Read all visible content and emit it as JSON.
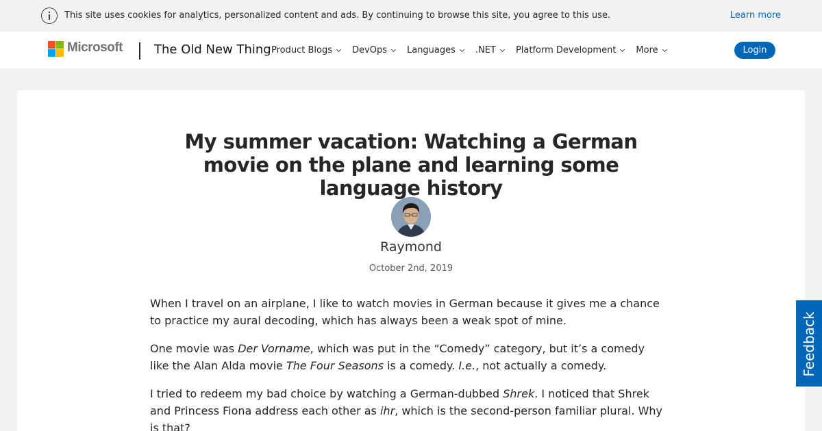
{
  "cookie": {
    "text": "This site uses cookies for analytics, personalized content and ads. By continuing to browse this site, you agree to this use.",
    "link": "Learn more"
  },
  "header": {
    "brand": "Microsoft",
    "site_title": "The Old New Thing",
    "nav": [
      "Product Blogs",
      "DevOps",
      "Languages",
      ".NET",
      "Platform Development",
      "More"
    ],
    "login": "Login"
  },
  "post": {
    "title": "My summer vacation: Watching a German movie on the plane and learning some language history",
    "author": "Raymond",
    "date": "October 2nd, 2019",
    "paragraphs": [
      [
        "When I travel on an airplane, I like to watch movies in German because it gives me a chance to practice my aural decoding, which has always been a weak spot of mine."
      ],
      [
        "One movie was ",
        "Der Vorname",
        ", which was put in the “Comedy” category, but it’s a comedy like the Alan Alda movie ",
        "The Four Seasons",
        " is a comedy. ",
        "I.e.",
        ", not actually a comedy."
      ],
      [
        "I tried to redeem my bad choice by watching a German-dubbed ",
        "Shrek",
        ". I noticed that Shrek and Princess Fiona address each other as ",
        "ihr",
        ", which is the second-person familiar plural. Why is that?"
      ]
    ]
  },
  "feedback": "Feedback",
  "colors": {
    "accent": "#0067b8",
    "page_bg": "#f2f2f2"
  }
}
